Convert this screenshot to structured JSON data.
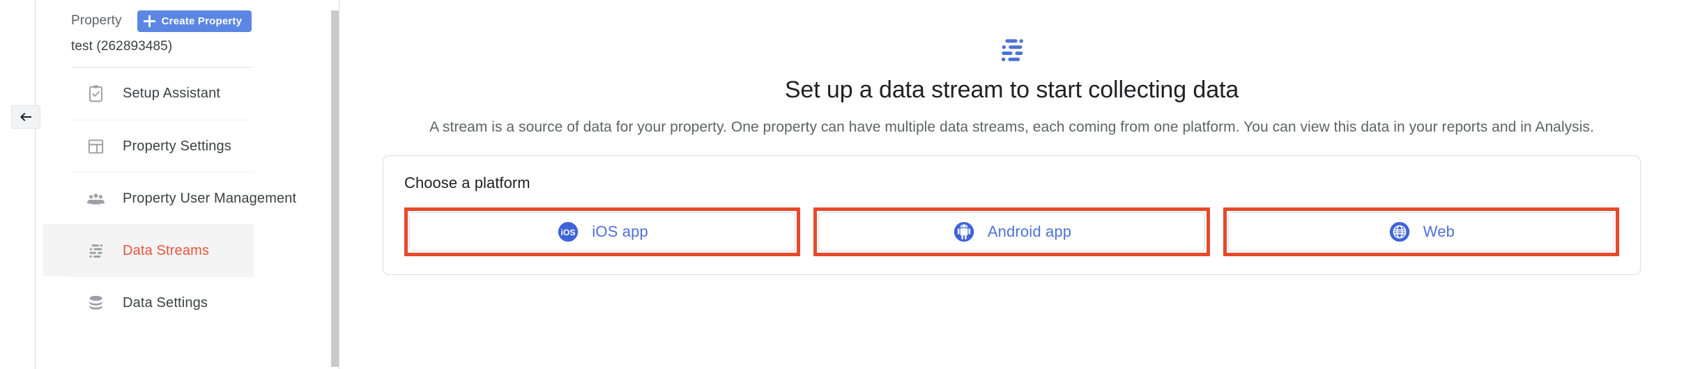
{
  "sidebar": {
    "collapse_icon": "back-arrow-icon",
    "property_label": "Property",
    "create_button": "Create Property",
    "property_name": "test (262893485)",
    "items": [
      {
        "label": "Setup Assistant",
        "icon": "clipboard-check-icon",
        "active": false
      },
      {
        "label": "Property Settings",
        "icon": "layout-panel-icon",
        "active": false
      },
      {
        "label": "Property User Management",
        "icon": "people-group-icon",
        "active": false
      },
      {
        "label": "Data Streams",
        "icon": "data-streams-icon",
        "active": true
      },
      {
        "label": "Data Settings",
        "icon": "database-stack-icon",
        "active": false
      }
    ]
  },
  "main": {
    "hero_icon": "data-streams-icon",
    "title": "Set up a data stream to start collecting data",
    "description": "A stream is a source of data for your property. One property can have multiple data streams, each coming from one platform. You can view this data in your reports and in Analysis.",
    "card": {
      "title": "Choose a platform",
      "platforms": [
        {
          "label": "iOS app",
          "icon": "ios-logo-icon"
        },
        {
          "label": "Android app",
          "icon": "android-logo-icon"
        },
        {
          "label": "Web",
          "icon": "globe-icon"
        }
      ]
    }
  },
  "colors": {
    "accent_blue": "#5b87e2",
    "link_blue": "#4d72d4",
    "active_red": "#e8553a",
    "highlight_red": "#e8492a",
    "muted_text": "#5f6368"
  }
}
